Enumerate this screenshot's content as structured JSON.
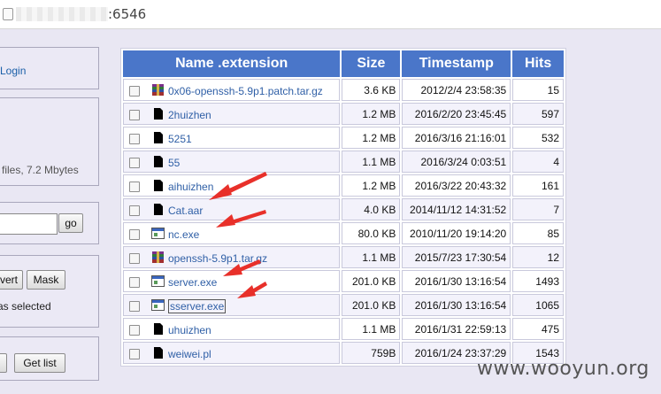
{
  "browser": {
    "url_visible": ":6546"
  },
  "left_panel": {
    "login_link": "Login",
    "files_info": "files, 7.2 Mbytes",
    "go_button": "go",
    "vert_button": "vert",
    "mask_button": "Mask",
    "selected_text": "as selected",
    "get_list_button": "Get list"
  },
  "table": {
    "headers": [
      "Name .extension",
      "Size",
      "Timestamp",
      "Hits"
    ],
    "rows": [
      {
        "name": "0x06-openssh-5.9p1.patch.tar.gz",
        "icon": "archive-icon",
        "size": "3.6 KB",
        "timestamp": "2012/2/4 23:58:35",
        "hits": "15"
      },
      {
        "name": "2huizhen",
        "icon": "file-icon",
        "size": "1.2 MB",
        "timestamp": "2016/2/20 23:45:45",
        "hits": "597"
      },
      {
        "name": "5251",
        "icon": "file-icon",
        "size": "1.2 MB",
        "timestamp": "2016/3/16 21:16:01",
        "hits": "532"
      },
      {
        "name": "55",
        "icon": "file-icon",
        "size": "1.1 MB",
        "timestamp": "2016/3/24 0:03:51",
        "hits": "4"
      },
      {
        "name": "aihuizhen",
        "icon": "file-icon",
        "size": "1.2 MB",
        "timestamp": "2016/3/22 20:43:32",
        "hits": "161"
      },
      {
        "name": "Cat.aar",
        "icon": "file-icon",
        "size": "4.0 KB",
        "timestamp": "2014/11/12 14:31:52",
        "hits": "7"
      },
      {
        "name": "nc.exe",
        "icon": "exe-icon",
        "size": "80.0 KB",
        "timestamp": "2010/11/20 19:14:20",
        "hits": "85"
      },
      {
        "name": "openssh-5.9p1.tar.gz",
        "icon": "archive-icon",
        "size": "1.1 MB",
        "timestamp": "2015/7/23 17:30:54",
        "hits": "12"
      },
      {
        "name": "server.exe",
        "icon": "exe-icon",
        "size": "201.0 KB",
        "timestamp": "2016/1/30 13:16:54",
        "hits": "1493"
      },
      {
        "name": "sserver.exe",
        "icon": "exe-icon",
        "size": "201.0 KB",
        "timestamp": "2016/1/30 13:16:54",
        "hits": "1065"
      },
      {
        "name": "uhuizhen",
        "icon": "file-icon",
        "size": "1.1 MB",
        "timestamp": "2016/1/31 22:59:13",
        "hits": "475"
      },
      {
        "name": "weiwei.pl",
        "icon": "file-icon",
        "size": "759B",
        "timestamp": "2016/1/24 23:37:29",
        "hits": "1543"
      }
    ]
  },
  "watermark": "www.wooyun.org",
  "colors": {
    "header_bg": "#4a76c9",
    "link": "#2f5fa6",
    "annotation_arrow": "#e8302a",
    "page_bg": "#e9e7f3"
  }
}
